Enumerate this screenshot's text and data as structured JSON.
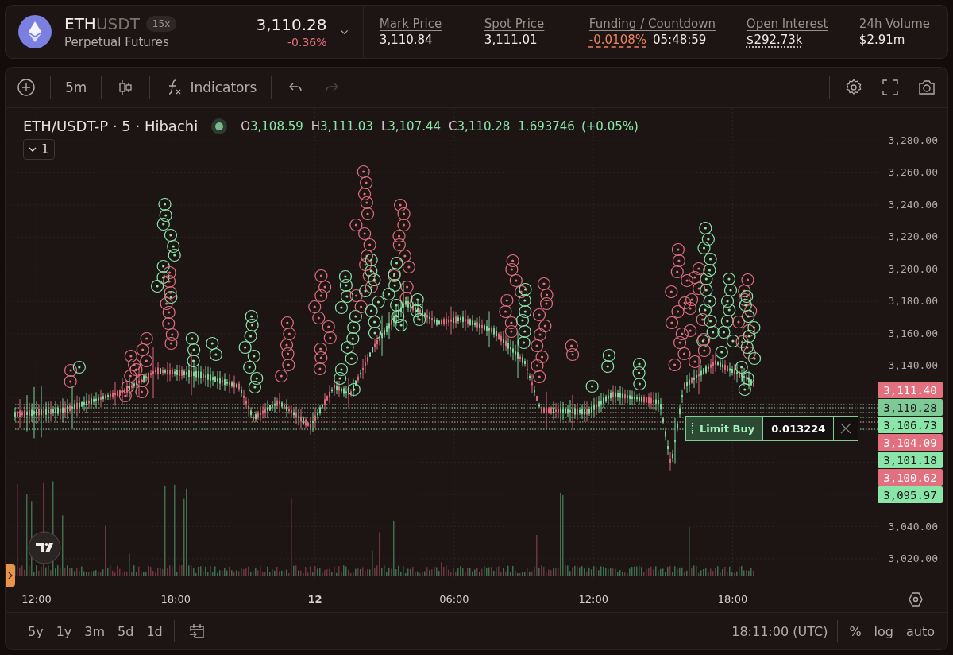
{
  "header": {
    "base": "ETH",
    "quote": "USDT",
    "leverage": "15x",
    "subtitle": "Perpetual Futures",
    "price": "3,110.28",
    "change": "-0.36%",
    "stats": [
      {
        "label": "Mark Price",
        "underline": true,
        "values": [
          {
            "text": "3,110.84",
            "kind": "plain"
          }
        ]
      },
      {
        "label": "Spot Price",
        "underline": true,
        "values": [
          {
            "text": "3,111.01",
            "kind": "plain"
          }
        ]
      },
      {
        "label": "Funding / Countdown",
        "underline": true,
        "values": [
          {
            "text": "-0.0108%",
            "kind": "funding"
          },
          {
            "text": "05:48:59",
            "kind": "plain"
          }
        ]
      },
      {
        "label": "Open Interest",
        "underline": true,
        "values": [
          {
            "text": "$292.73k",
            "kind": "dotted"
          }
        ]
      },
      {
        "label": "24h Volume",
        "underline": false,
        "values": [
          {
            "text": "$2.91m",
            "kind": "plain"
          }
        ]
      }
    ]
  },
  "toolbar": {
    "interval": "5m",
    "indicators": "Indicators",
    "redo_disabled": true
  },
  "legend": {
    "symbol": "ETH/USDT-P · 5 · Hibachi",
    "ohlc": [
      {
        "key": "O",
        "value": "3,108.59"
      },
      {
        "key": "H",
        "value": "3,111.03"
      },
      {
        "key": "L",
        "value": "3,107.44"
      },
      {
        "key": "C",
        "value": "3,110.28"
      }
    ],
    "volume": "1.693746",
    "change": "(+0.05%)",
    "collapse": "1"
  },
  "price_axis": {
    "upper": [
      "3,280.00",
      "3,260.00",
      "3,240.00",
      "3,220.00",
      "3,200.00",
      "3,180.00",
      "3,160.00",
      "3,140.00"
    ],
    "lower": [
      "3,040.00",
      "3,020.00"
    ]
  },
  "price_tags": [
    {
      "text": "3,111.40",
      "kind": "sell"
    },
    {
      "text": "3,110.28",
      "kind": "last"
    },
    {
      "text": "3,106.73",
      "kind": "buy"
    },
    {
      "text": "3,104.09",
      "kind": "sell"
    },
    {
      "text": "3,101.18",
      "kind": "buy"
    },
    {
      "text": "3,100.62",
      "kind": "sell"
    },
    {
      "text": "3,095.97",
      "kind": "buy"
    }
  ],
  "order": {
    "kind": "buy",
    "label": "Limit Buy",
    "quantity": "0.013224"
  },
  "time_axis": [
    {
      "text": "12:00",
      "kind": "time"
    },
    {
      "text": "18:00",
      "kind": "time"
    },
    {
      "text": "12",
      "kind": "day"
    },
    {
      "text": "06:00",
      "kind": "time"
    },
    {
      "text": "12:00",
      "kind": "time"
    },
    {
      "text": "18:00",
      "kind": "time"
    }
  ],
  "ranges": [
    "5y",
    "1y",
    "3m",
    "5d",
    "1d"
  ],
  "footer": {
    "clock": "18:11:00 (UTC)",
    "options": [
      "%",
      "log",
      "auto"
    ]
  }
}
